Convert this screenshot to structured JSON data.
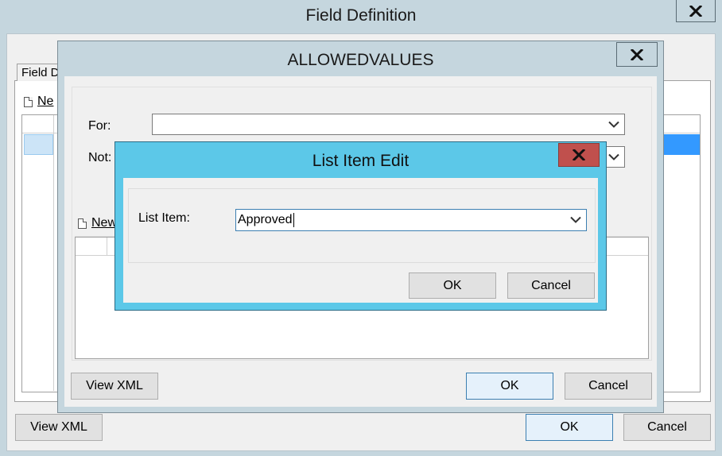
{
  "field_definition": {
    "title": "Field Definition",
    "tab_label": "Field D",
    "new_label": "Ne",
    "view_xml_label": "View XML",
    "ok_label": "OK",
    "cancel_label": "Cancel"
  },
  "allowed_values": {
    "title": "ALLOWEDVALUES",
    "for_label": "For:",
    "for_value": "",
    "not_label": "Not:",
    "not_value": "",
    "new_label": "New",
    "view_xml_label": "View XML",
    "ok_label": "OK",
    "cancel_label": "Cancel"
  },
  "list_item_edit": {
    "title": "List Item Edit",
    "list_item_label": "List Item:",
    "list_item_value": "Approved",
    "ok_label": "OK",
    "cancel_label": "Cancel"
  },
  "icons": {
    "close": "close-icon",
    "dropdown": "chevron-down-icon",
    "new": "new-document-icon"
  },
  "colors": {
    "title_bar": "#c5d6de",
    "active_dialog": "#5cc8e8",
    "close_active": "#c0504d",
    "selection": "#3399ff"
  }
}
